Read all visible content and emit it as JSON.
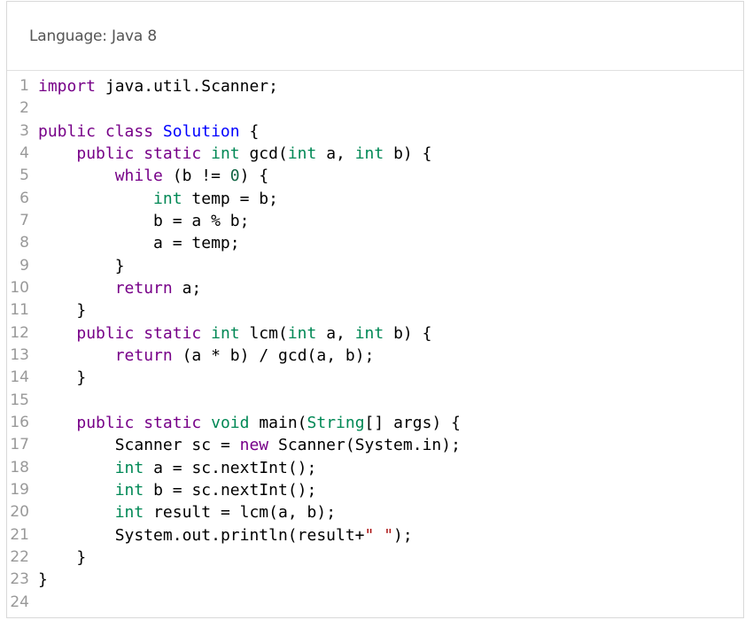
{
  "header": {
    "language_label": "Language: Java 8"
  },
  "editor": {
    "lines": [
      {
        "n": "1",
        "code": "import java.util.Scanner;"
      },
      {
        "n": "2",
        "code": ""
      },
      {
        "n": "3",
        "code": "public class Solution {"
      },
      {
        "n": "4",
        "code": "    public static int gcd(int a, int b) {"
      },
      {
        "n": "5",
        "code": "        while (b != 0) {"
      },
      {
        "n": "6",
        "code": "            int temp = b;"
      },
      {
        "n": "7",
        "code": "            b = a % b;"
      },
      {
        "n": "8",
        "code": "            a = temp;"
      },
      {
        "n": "9",
        "code": "        }"
      },
      {
        "n": "10",
        "code": "        return a;"
      },
      {
        "n": "11",
        "code": "    }"
      },
      {
        "n": "12",
        "code": "    public static int lcm(int a, int b) {"
      },
      {
        "n": "13",
        "code": "        return (a * b) / gcd(a, b);"
      },
      {
        "n": "14",
        "code": "    }"
      },
      {
        "n": "15",
        "code": ""
      },
      {
        "n": "16",
        "code": "    public static void main(String[] args) {"
      },
      {
        "n": "17",
        "code": "        Scanner sc = new Scanner(System.in);"
      },
      {
        "n": "18",
        "code": "        int a = sc.nextInt();"
      },
      {
        "n": "19",
        "code": "        int b = sc.nextInt();"
      },
      {
        "n": "20",
        "code": "        int result = lcm(a, b);"
      },
      {
        "n": "21",
        "code": "        System.out.println(result+\" \");"
      },
      {
        "n": "22",
        "code": "    }"
      },
      {
        "n": "23",
        "code": "}"
      },
      {
        "n": "24",
        "code": ""
      }
    ]
  },
  "colors": {
    "keyword": "#770088",
    "type": "#008855",
    "definition": "#0000ff",
    "number": "#116644",
    "string": "#aa1111"
  }
}
